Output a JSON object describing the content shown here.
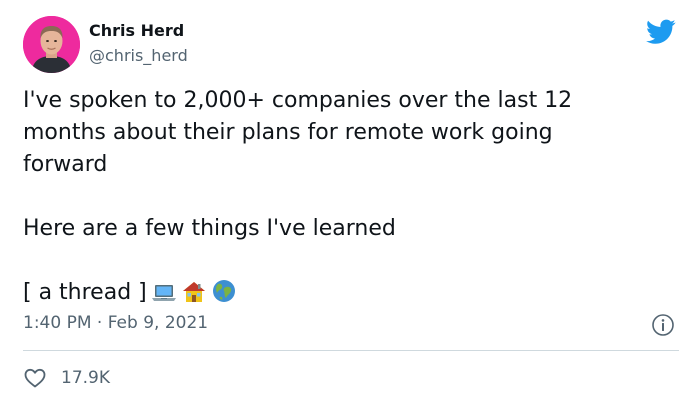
{
  "author": {
    "name": "Chris Herd",
    "handle": "@chris_herd"
  },
  "tweet": {
    "lines": [
      "I've spoken to 2,000+ companies over the last 12",
      "months about their plans for remote work going",
      "forward",
      "",
      "Here are a few things I've learned",
      "",
      "[ a thread ]"
    ],
    "emojis": [
      "laptop-emoji",
      "house-emoji",
      "globe-emoji"
    ],
    "timestamp": "1:40 PM · Feb 9, 2021"
  },
  "engagement": {
    "likes": "17.9K"
  },
  "colors": {
    "twitter_blue": "#1d9bf0",
    "avatar_background": "#ee2a9e",
    "secondary_text": "#536471",
    "divider": "#cfd9de"
  },
  "icons": {
    "brand": "twitter-bird-icon",
    "info": "info-icon",
    "like": "heart-icon"
  }
}
